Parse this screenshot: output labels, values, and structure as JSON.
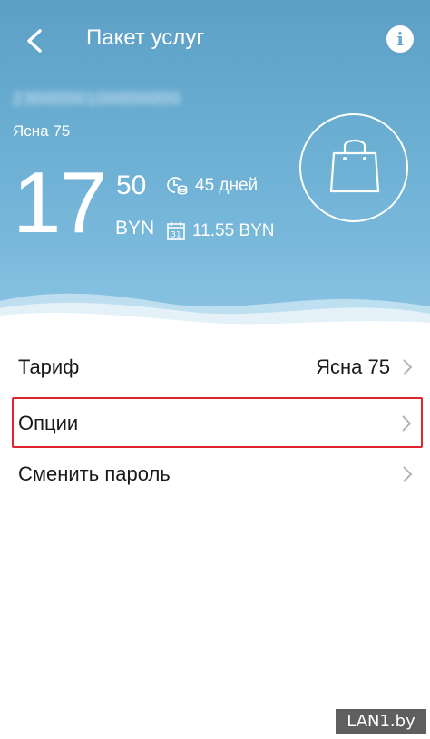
{
  "header": {
    "title": "Пакет услуг",
    "back_icon": "chevron-left-icon",
    "info_icon": "info-icon",
    "info_glyph": "i"
  },
  "account": {
    "number": "2300000100000000",
    "tariff_name": "Ясна 75"
  },
  "balance": {
    "integer": "17",
    "fraction": "50",
    "currency": "BYN"
  },
  "days": {
    "icon": "clock-coins-icon",
    "text": "45 дней"
  },
  "fee": {
    "icon": "calendar-icon",
    "calendar_day": "31",
    "text": "11.55 BYN"
  },
  "shop": {
    "icon": "shopping-bag-icon"
  },
  "menu": {
    "items": [
      {
        "label": "Тариф",
        "value": "Ясна 75"
      },
      {
        "label": "Опции",
        "value": ""
      },
      {
        "label": "Сменить пароль",
        "value": ""
      }
    ]
  },
  "watermark": "LAN1.by",
  "colors": {
    "header_top": "#5d9fc5",
    "header_bottom": "#8ec6e4",
    "highlight": "#e0242e",
    "text": "#1a1a1a"
  }
}
